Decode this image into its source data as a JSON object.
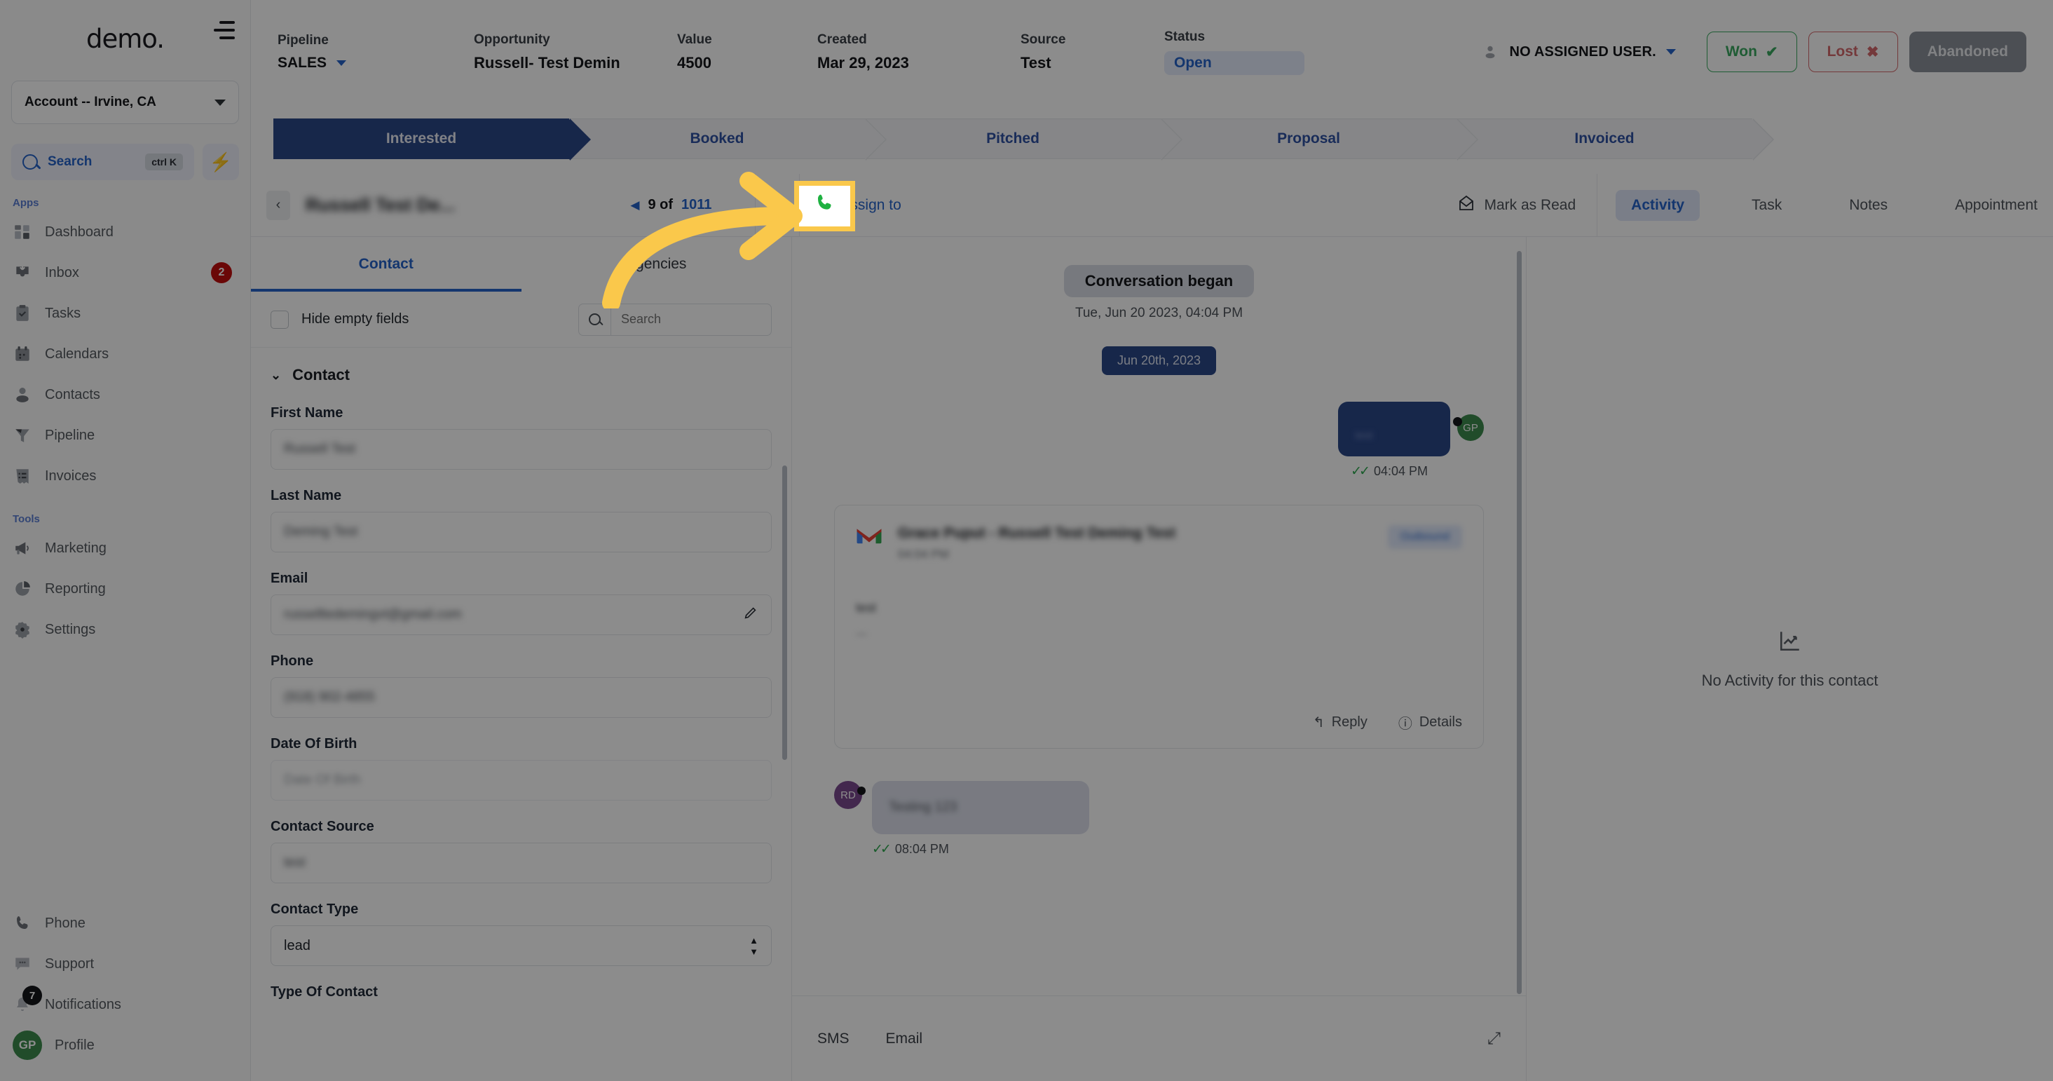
{
  "sidebar": {
    "brand": "demo.",
    "hamburger_icon": "hamburger-menu-icon",
    "account_selector": {
      "label": "Account -- Irvine, CA",
      "chevron_icon": "chevron-down-icon"
    },
    "search": {
      "label": "Search",
      "shortcut": "ctrl K",
      "icon": "search-icon"
    },
    "quick_action_icon": "lightning-bolt-icon",
    "apps_label": "Apps",
    "tools_label": "Tools",
    "apps": [
      {
        "label": "Dashboard",
        "icon": "dashboard-icon",
        "badge": ""
      },
      {
        "label": "Inbox",
        "icon": "inbox-icon",
        "badge": "2"
      },
      {
        "label": "Tasks",
        "icon": "tasks-clipboard-icon",
        "badge": ""
      },
      {
        "label": "Calendars",
        "icon": "calendar-icon",
        "badge": ""
      },
      {
        "label": "Contacts",
        "icon": "contacts-person-icon",
        "badge": ""
      },
      {
        "label": "Pipeline",
        "icon": "pipeline-funnel-icon",
        "badge": ""
      },
      {
        "label": "Invoices",
        "icon": "invoice-list-icon",
        "badge": ""
      }
    ],
    "tools": [
      {
        "label": "Marketing",
        "icon": "megaphone-icon",
        "badge": ""
      },
      {
        "label": "Reporting",
        "icon": "pie-chart-icon",
        "badge": ""
      },
      {
        "label": "Settings",
        "icon": "gear-icon",
        "badge": ""
      }
    ],
    "bottom": [
      {
        "label": "Phone",
        "icon": "phone-icon",
        "badge": ""
      },
      {
        "label": "Support",
        "icon": "support-chat-icon",
        "badge": ""
      },
      {
        "label": "Notifications",
        "icon": "bell-icon",
        "badge": "7"
      },
      {
        "label": "Profile",
        "icon": "avatar-icon",
        "badge": "",
        "initials": "GP"
      }
    ]
  },
  "header": {
    "fields": [
      {
        "key": "Pipeline",
        "value": "SALES"
      },
      {
        "key": "Opportunity",
        "value": "Russell- Test Demin"
      },
      {
        "key": "Value",
        "value": "4500"
      },
      {
        "key": "Created",
        "value": "Mar 29, 2023"
      },
      {
        "key": "Source",
        "value": "Test"
      },
      {
        "key": "Status",
        "value": "Open"
      }
    ],
    "assigned_user": "NO ASSIGNED USER.",
    "assigned_icon": "person-icon",
    "assigned_chevron": "chevron-down-icon",
    "won_label": "Won",
    "won_icon": "check-icon",
    "lost_label": "Lost",
    "lost_icon": "x-icon",
    "abandoned_label": "Abandoned",
    "colors": {
      "won": "#39a860",
      "lost": "#d4696c",
      "abandoned": "#8a9099",
      "accent": "#2563c9",
      "active_stage": "#2a4788"
    }
  },
  "stages": [
    {
      "label": "Interested",
      "active": true
    },
    {
      "label": "Booked",
      "active": false
    },
    {
      "label": "Pitched",
      "active": false
    },
    {
      "label": "Proposal",
      "active": false
    },
    {
      "label": "Invoiced",
      "active": false
    }
  ],
  "contact_header": {
    "back_icon": "chevron-left-icon",
    "contact_name": "Russell Test De...",
    "pager": {
      "prev_icon": "triangle-left-icon",
      "current": "9 of",
      "total": "1011"
    },
    "call_icon": "phone-call-icon",
    "assign_to_label": "Assign to",
    "assign_to_icon": "plus-circle-icon",
    "mark_as_read_label": "Mark as Read",
    "mark_as_read_icon": "envelope-open-icon",
    "tabs": [
      {
        "label": "Activity",
        "active": true
      },
      {
        "label": "Task",
        "active": false
      },
      {
        "label": "Notes",
        "active": false
      },
      {
        "label": "Appointment",
        "active": false
      }
    ]
  },
  "contact_panel": {
    "tabs": [
      {
        "label": "Contact",
        "active": true
      },
      {
        "label": "Agencies",
        "active": false
      }
    ],
    "hide_empty_fields_label": "Hide empty fields",
    "search_placeholder": "Search",
    "search_icon": "search-icon",
    "group_label": "Contact",
    "group_chevron": "chevron-down-icon",
    "fields": [
      {
        "label": "First Name",
        "value": "Russell Test",
        "redacted": true,
        "type": "text"
      },
      {
        "label": "Last Name",
        "value": "Deming Test",
        "redacted": true,
        "type": "text"
      },
      {
        "label": "Email",
        "value": "russelltedemingvt@gmail.com",
        "redacted": true,
        "type": "text",
        "edit_icon": "pencil-icon"
      },
      {
        "label": "Phone",
        "value": "(918) 902-4855",
        "redacted": true,
        "type": "text"
      },
      {
        "label": "Date Of Birth",
        "value": "Date Of Birth",
        "redacted": true,
        "type": "placeholder"
      },
      {
        "label": "Contact Source",
        "value": "test",
        "redacted": true,
        "type": "text"
      },
      {
        "label": "Contact Type",
        "value": "lead",
        "redacted": false,
        "type": "select"
      },
      {
        "label": "Type Of Contact",
        "value": "",
        "redacted": false,
        "type": "text"
      }
    ]
  },
  "conversation": {
    "began_label": "Conversation began",
    "began_date": "Tue, Jun 20 2023, 04:04 PM",
    "day_chip": "Jun 20th, 2023",
    "outgoing_bubble": {
      "text": "test",
      "redacted": true,
      "time": "04:04 PM",
      "status_icon": "double-check-icon",
      "avatar_initials": "GP"
    },
    "email_card": {
      "provider_icon": "gmail-icon",
      "subject": "Grace Puput - Russell Test Deming Test",
      "time": "04:04 PM",
      "chip": "Outbound",
      "body_line1": "test",
      "body_line2": "---",
      "reply_label": "Reply",
      "reply_icon": "reply-arrow-icon",
      "details_label": "Details",
      "details_icon": "info-circle-icon"
    },
    "incoming_bubble": {
      "text": "Testing 123",
      "redacted": true,
      "time": "08:04 PM",
      "status_icon": "double-check-icon",
      "avatar_initials": "RD"
    },
    "composer": {
      "tabs": [
        {
          "label": "SMS"
        },
        {
          "label": "Email"
        }
      ],
      "expand_icon": "expand-diagonal-icon"
    }
  },
  "activity_panel": {
    "empty_icon": "chart-line-icon",
    "empty_text": "No Activity for this contact"
  },
  "callout": {
    "target_icon": "phone-call-icon",
    "highlight_color": "#fac84b",
    "arrow_icon": "curved-arrow-right-icon"
  }
}
